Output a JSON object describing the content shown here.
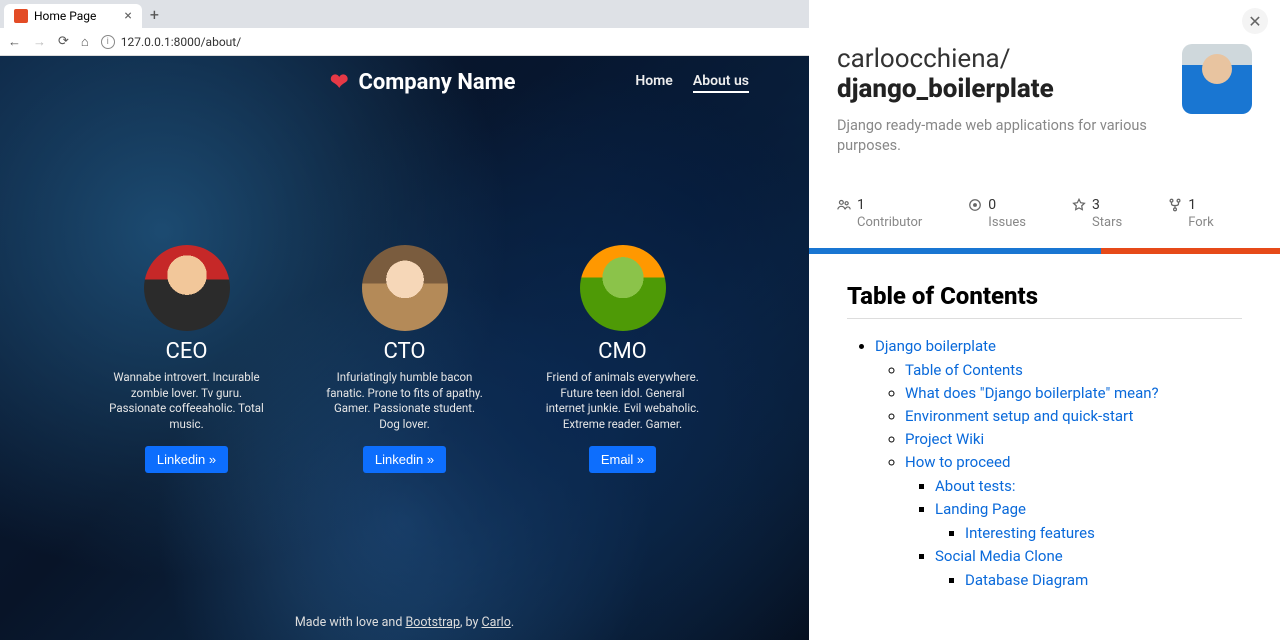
{
  "browser": {
    "tab_title": "Home Page",
    "url": "127.0.0.1:8000/about/"
  },
  "site": {
    "brand": "Company Name",
    "nav": {
      "home": "Home",
      "about": "About us"
    },
    "team": [
      {
        "role": "CEO",
        "blurb": "Wannabe introvert. Incurable zombie lover. Tv guru. Passionate coffeeaholic. Total music.",
        "cta": "Linkedin »"
      },
      {
        "role": "CTO",
        "blurb": "Infuriatingly humble bacon fanatic. Prone to fits of apathy. Gamer. Passionate student. Dog lover.",
        "cta": "Linkedin »"
      },
      {
        "role": "CMO",
        "blurb": "Friend of animals everywhere. Future teen idol. General internet junkie. Evil webaholic. Extreme reader. Gamer.",
        "cta": "Email »"
      }
    ],
    "footer": {
      "prefix": "Made with love and ",
      "lib": "Bootstrap",
      "mid": ", by ",
      "author": "Carlo",
      "suffix": "."
    }
  },
  "repo": {
    "owner": "carloocchiena/",
    "name": "django_boilerplate",
    "description": "Django ready-made web applications for various purposes.",
    "stats": {
      "contributors": {
        "value": "1",
        "label": "Contributor"
      },
      "issues": {
        "value": "0",
        "label": "Issues"
      },
      "stars": {
        "value": "3",
        "label": "Stars"
      },
      "forks": {
        "value": "1",
        "label": "Fork"
      }
    },
    "toc_title": "Table of Contents",
    "toc": {
      "l1": "Django boilerplate",
      "l2": [
        "Table of Contents",
        "What does \"Django boilerplate\" mean?",
        "Environment setup and quick-start",
        "Project Wiki",
        "How to proceed"
      ],
      "proceed": {
        "about_tests": "About tests:",
        "landing": "Landing Page",
        "landing_sub": "Interesting features",
        "social": "Social Media Clone",
        "social_sub": "Database Diagram"
      }
    }
  }
}
